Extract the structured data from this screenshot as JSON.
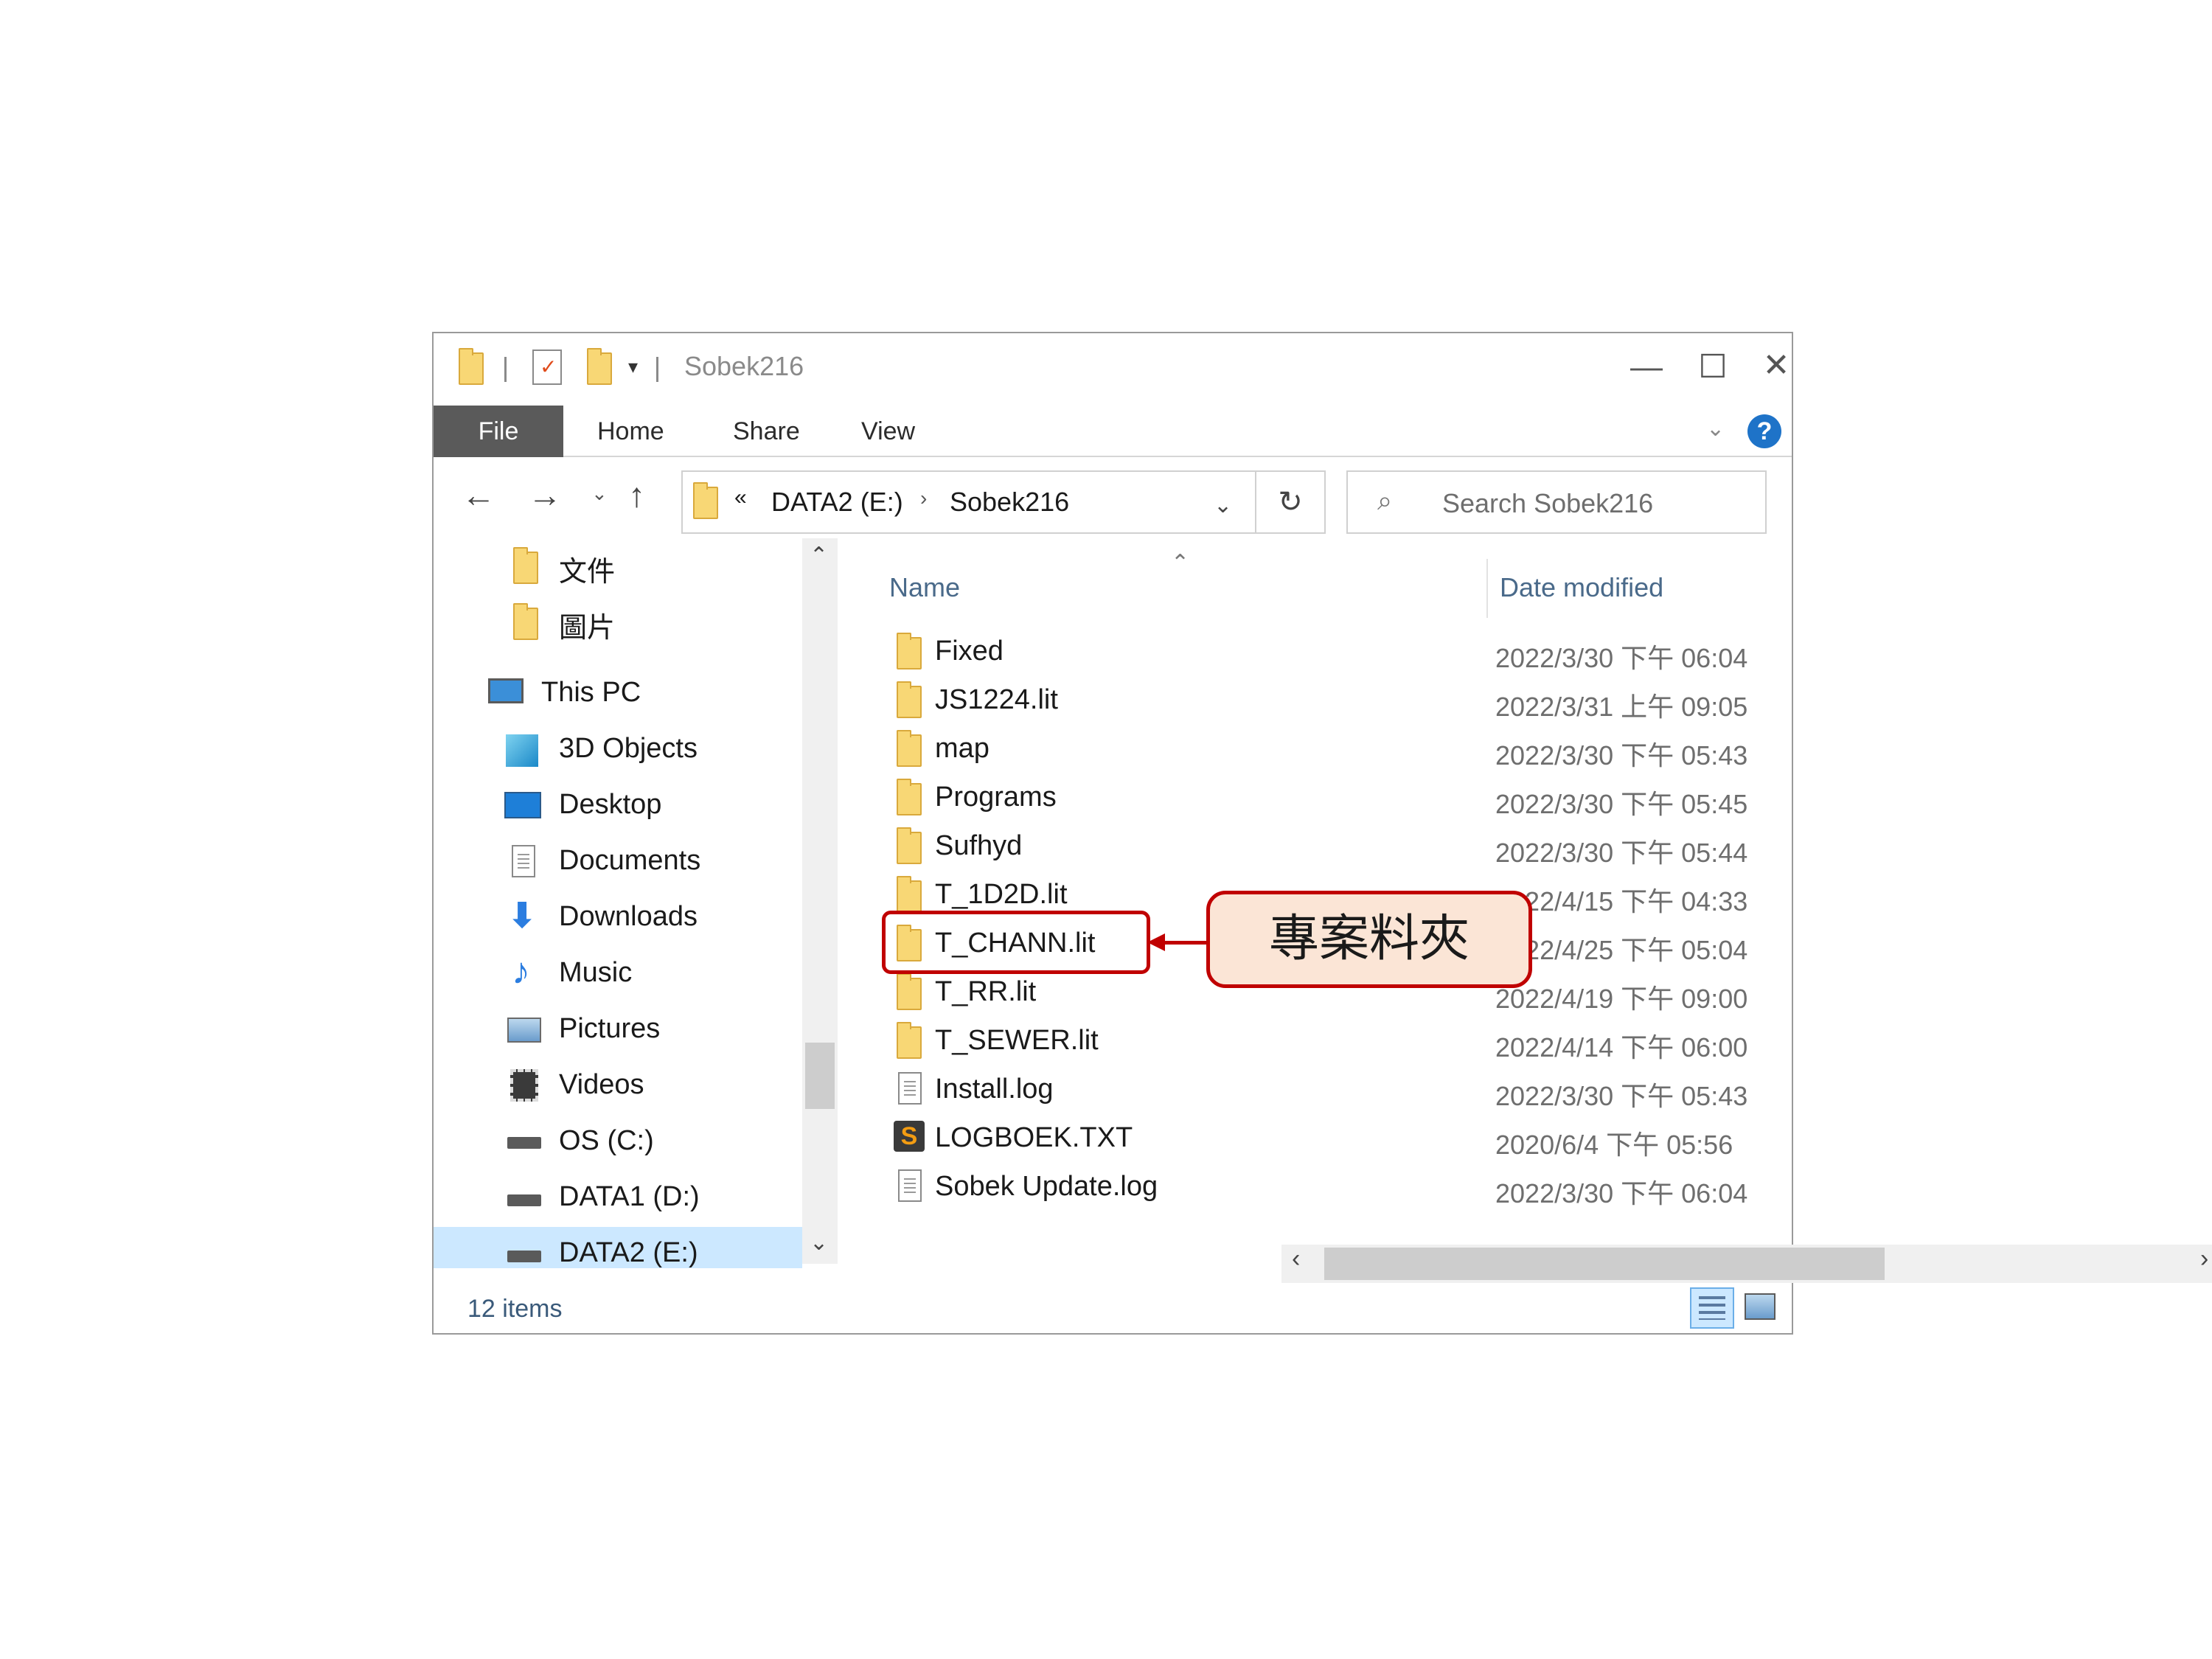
{
  "window": {
    "title": "Sobek216"
  },
  "ribbon": {
    "tabs": [
      {
        "label": "File"
      },
      {
        "label": "Home"
      },
      {
        "label": "Share"
      },
      {
        "label": "View"
      }
    ]
  },
  "address": {
    "overflow": "«",
    "crumbs": [
      "DATA2 (E:)",
      "Sobek216"
    ]
  },
  "search": {
    "placeholder": "Search Sobek216"
  },
  "nav_pane": {
    "items": [
      {
        "label": "文件",
        "icon": "folder-icon"
      },
      {
        "label": "圖片",
        "icon": "folder-icon"
      },
      {
        "label": "This PC",
        "icon": "computer-icon"
      },
      {
        "label": "3D Objects",
        "icon": "cube-icon"
      },
      {
        "label": "Desktop",
        "icon": "desktop-icon"
      },
      {
        "label": "Documents",
        "icon": "documents-icon"
      },
      {
        "label": "Downloads",
        "icon": "download-arrow-icon"
      },
      {
        "label": "Music",
        "icon": "music-note-icon"
      },
      {
        "label": "Pictures",
        "icon": "pictures-icon"
      },
      {
        "label": "Videos",
        "icon": "film-icon"
      },
      {
        "label": "OS (C:)",
        "icon": "drive-icon"
      },
      {
        "label": "DATA1 (D:)",
        "icon": "drive-icon"
      },
      {
        "label": "DATA2 (E:)",
        "icon": "drive-icon"
      }
    ]
  },
  "columns": {
    "name": "Name",
    "date": "Date modified"
  },
  "files": [
    {
      "name": "Fixed",
      "date": "2022/3/30 下午 06:04",
      "type": "folder"
    },
    {
      "name": "JS1224.lit",
      "date": "2022/3/31 上午 09:05",
      "type": "folder"
    },
    {
      "name": "map",
      "date": "2022/3/30 下午 05:43",
      "type": "folder"
    },
    {
      "name": "Programs",
      "date": "2022/3/30 下午 05:45",
      "type": "folder"
    },
    {
      "name": "Sufhyd",
      "date": "2022/3/30 下午 05:44",
      "type": "folder"
    },
    {
      "name": "T_1D2D.lit",
      "date": "2022/4/15 下午 04:33",
      "type": "folder"
    },
    {
      "name": "T_CHANN.lit",
      "date": "2022/4/25 下午 05:04",
      "type": "folder"
    },
    {
      "name": "T_RR.lit",
      "date": "2022/4/19 下午 09:00",
      "type": "folder"
    },
    {
      "name": "T_SEWER.lit",
      "date": "2022/4/14 下午 06:00",
      "type": "folder"
    },
    {
      "name": "Install.log",
      "date": "2022/3/30 下午 05:43",
      "type": "file"
    },
    {
      "name": "LOGBOEK.TXT",
      "date": "2020/6/4 下午 05:56",
      "type": "sublime"
    },
    {
      "name": "Sobek Update.log",
      "date": "2022/3/30 下午 06:04",
      "type": "file"
    }
  ],
  "status": {
    "count": "12 items"
  },
  "annotation": {
    "callout_text": "專案料夾"
  },
  "colors": {
    "accent": "#c00000",
    "callout_fill": "#fbe5d6",
    "file_tab": "#5a5a5a"
  }
}
